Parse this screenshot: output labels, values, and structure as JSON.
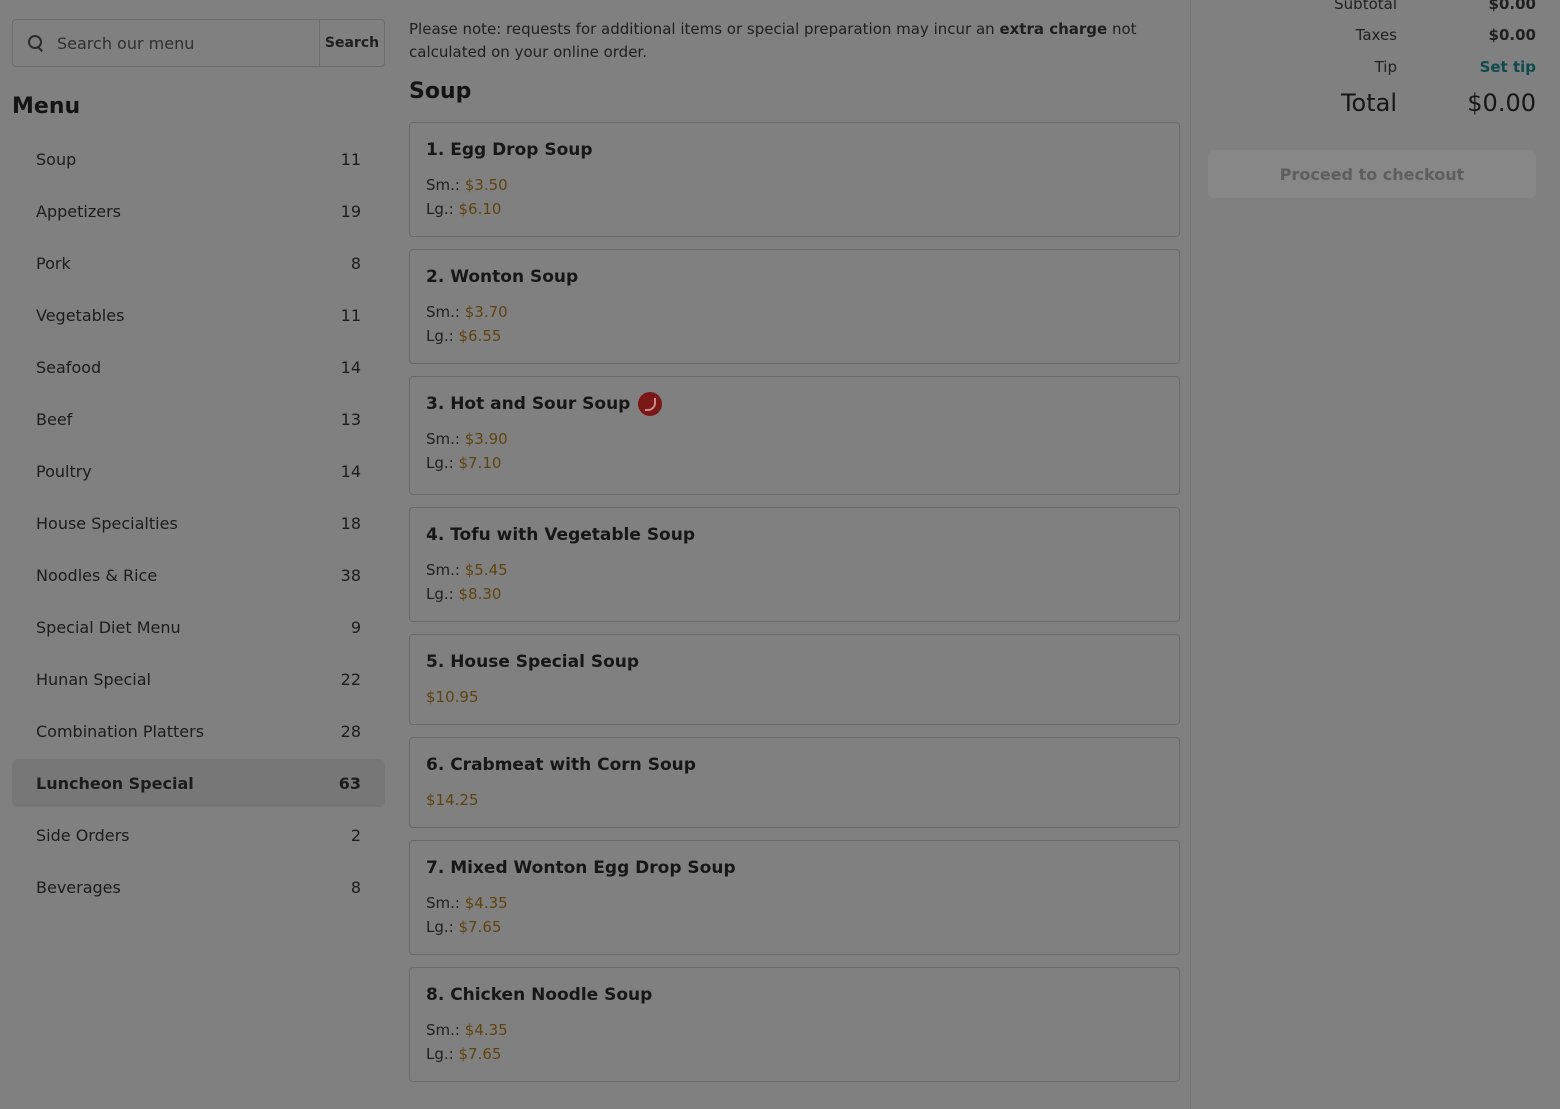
{
  "search": {
    "placeholder": "Search our menu",
    "button_label": "Search"
  },
  "menu": {
    "title": "Menu",
    "items": [
      {
        "label": "Soup",
        "count": "11"
      },
      {
        "label": "Appetizers",
        "count": "19"
      },
      {
        "label": "Pork",
        "count": "8"
      },
      {
        "label": "Vegetables",
        "count": "11"
      },
      {
        "label": "Seafood",
        "count": "14"
      },
      {
        "label": "Beef",
        "count": "13"
      },
      {
        "label": "Poultry",
        "count": "14"
      },
      {
        "label": "House Specialties",
        "count": "18"
      },
      {
        "label": "Noodles & Rice",
        "count": "38"
      },
      {
        "label": "Special Diet Menu",
        "count": "9"
      },
      {
        "label": "Hunan Special",
        "count": "22"
      },
      {
        "label": "Combination Platters",
        "count": "28"
      },
      {
        "label": "Luncheon Special",
        "count": "63",
        "active": true
      },
      {
        "label": "Side Orders",
        "count": "2"
      },
      {
        "label": "Beverages",
        "count": "8"
      }
    ]
  },
  "notice": {
    "prefix": "Please note: requests for additional items or special preparation may incur an ",
    "bold": "extra charge",
    "suffix": " not calculated on your online order."
  },
  "section": {
    "title": "Soup"
  },
  "soup_items": [
    {
      "name": "1. Egg Drop Soup",
      "prices": [
        {
          "label": "Sm.:",
          "value": "$3.50"
        },
        {
          "label": "Lg.:",
          "value": "$6.10"
        }
      ]
    },
    {
      "name": "2. Wonton Soup",
      "prices": [
        {
          "label": "Sm.:",
          "value": "$3.70"
        },
        {
          "label": "Lg.:",
          "value": "$6.55"
        }
      ]
    },
    {
      "name": "3. Hot and Sour Soup",
      "spicy": true,
      "prices": [
        {
          "label": "Sm.:",
          "value": "$3.90"
        },
        {
          "label": "Lg.:",
          "value": "$7.10"
        }
      ]
    },
    {
      "name": "4. Tofu with Vegetable Soup",
      "prices": [
        {
          "label": "Sm.:",
          "value": "$5.45"
        },
        {
          "label": "Lg.:",
          "value": "$8.30"
        }
      ]
    },
    {
      "name": "5. House Special Soup",
      "prices": [
        {
          "label": "",
          "value": "$10.95"
        }
      ]
    },
    {
      "name": "6. Crabmeat with Corn Soup",
      "prices": [
        {
          "label": "",
          "value": "$14.25"
        }
      ]
    },
    {
      "name": "7. Mixed Wonton Egg Drop Soup",
      "prices": [
        {
          "label": "Sm.:",
          "value": "$4.35"
        },
        {
          "label": "Lg.:",
          "value": "$7.65"
        }
      ]
    },
    {
      "name": "8. Chicken Noodle Soup",
      "prices": [
        {
          "label": "Sm.:",
          "value": "$4.35"
        },
        {
          "label": "Lg.:",
          "value": "$7.65"
        }
      ]
    }
  ],
  "order_summary": {
    "subtotal_label": "Subtotal",
    "subtotal_value": "$0.00",
    "taxes_label": "Taxes",
    "taxes_value": "$0.00",
    "tip_label": "Tip",
    "tip_link": "Set tip",
    "total_label": "Total",
    "total_value": "$0.00",
    "checkout_label": "Proceed to checkout"
  },
  "colors": {
    "overlay_bg": "#808080",
    "price": "#5e4310",
    "link": "#0f4a4d",
    "spicy_icon": "#7a1818"
  }
}
